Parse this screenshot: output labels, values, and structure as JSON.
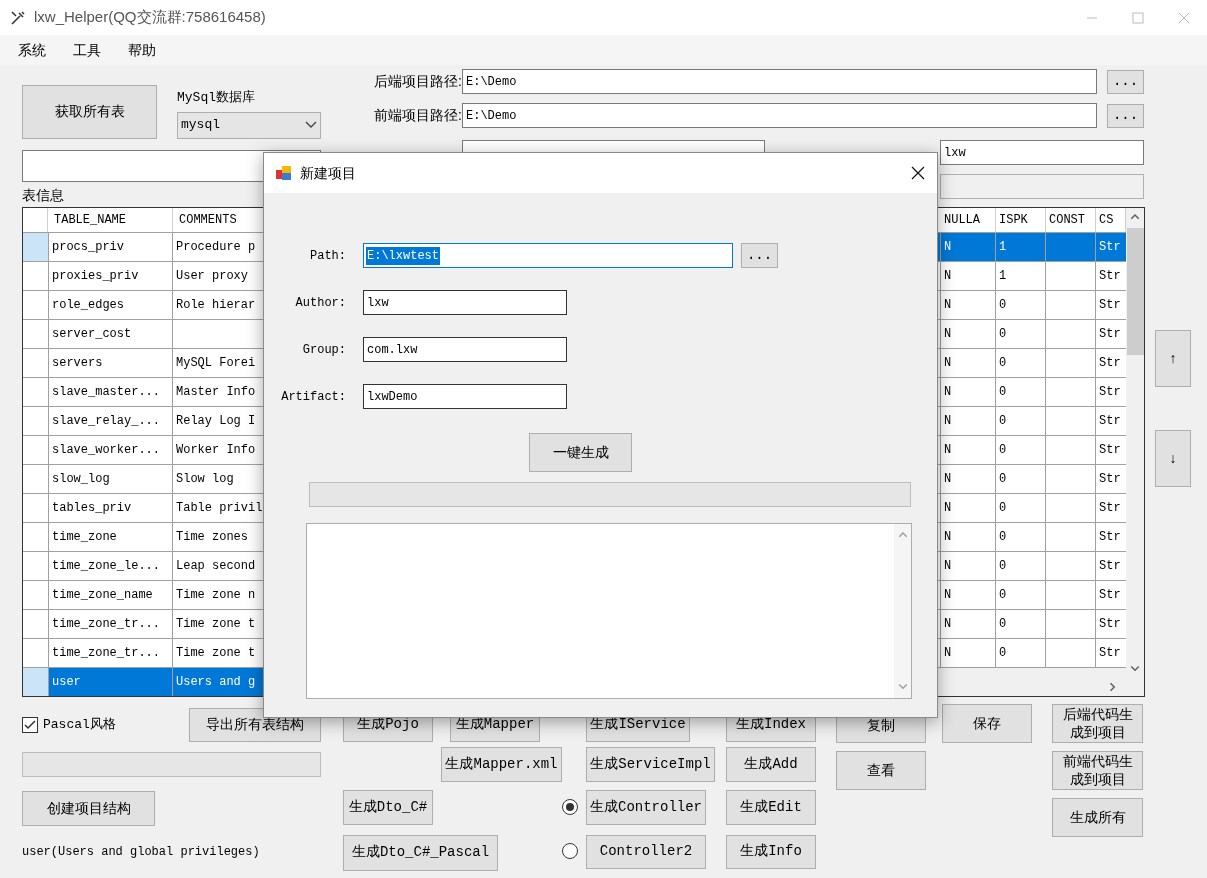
{
  "window": {
    "title": "lxw_Helper(QQ交流群:758616458)"
  },
  "menu": [
    "系统",
    "工具",
    "帮助"
  ],
  "fetch_tables_button": "获取所有表",
  "database": {
    "label": "MySql数据库",
    "value": "mysql"
  },
  "paths": [
    {
      "label": "后端项目路径:",
      "value": "E:\\Demo",
      "browse": "..."
    },
    {
      "label": "前端项目路径:",
      "value": "E:\\Demo",
      "browse": "..."
    }
  ],
  "author": {
    "value": "lxw"
  },
  "progress": {
    "level": 0
  },
  "table_info_label": "表信息",
  "tables_grid": {
    "columns": [
      "TABLE_NAME",
      "COMMENTS"
    ],
    "rows": [
      {
        "name": "procs_priv",
        "comment": "Procedure p",
        "selected": false
      },
      {
        "name": "proxies_priv",
        "comment": "User proxy",
        "selected": false
      },
      {
        "name": "role_edges",
        "comment": "Role hierar",
        "selected": false
      },
      {
        "name": "server_cost",
        "selected": false
      },
      {
        "name": "servers",
        "comment": "MySQL Forei",
        "selected": false
      },
      {
        "name": "slave_master...",
        "comment": "Master Info",
        "selected": false
      },
      {
        "name": "slave_relay_...",
        "comment": "Relay Log I",
        "selected": false
      },
      {
        "name": "slave_worker...",
        "comment": "Worker Info",
        "selected": false
      },
      {
        "name": "slow_log",
        "comment": "Slow log",
        "selected": false
      },
      {
        "name": "tables_priv",
        "comment": "Table privil",
        "selected": false
      },
      {
        "name": "time_zone",
        "comment": "Time zones",
        "selected": false
      },
      {
        "name": "time_zone_le...",
        "comment": "Leap second",
        "selected": false
      },
      {
        "name": "time_zone_name",
        "comment": "Time zone n",
        "selected": false
      },
      {
        "name": "time_zone_tr...",
        "comment": "Time zone t",
        "selected": false
      },
      {
        "name": "time_zone_tr...",
        "comment": "Time zone t",
        "selected": false
      },
      {
        "name": "user",
        "comment": "Users and g",
        "selected": true
      }
    ]
  },
  "columns_grid": {
    "columns": [
      "NULLA",
      "ISPK",
      "CONST",
      "CS"
    ],
    "rows": [
      {
        "nullable": "N",
        "ispk": "1",
        "type": "Str",
        "selected": true
      },
      {
        "nullable": "N",
        "ispk": "1",
        "type": "Str",
        "selected": false
      },
      {
        "nullable": "N",
        "ispk": "0",
        "type": "Str",
        "selected": false
      },
      {
        "nullable": "N",
        "ispk": "0",
        "type": "Str",
        "selected": false
      },
      {
        "nullable": "N",
        "ispk": "0",
        "type": "Str",
        "selected": false
      },
      {
        "nullable": "N",
        "ispk": "0",
        "type": "Str",
        "selected": false
      },
      {
        "nullable": "N",
        "ispk": "0",
        "type": "Str",
        "selected": false
      },
      {
        "nullable": "N",
        "ispk": "0",
        "type": "Str",
        "selected": false
      },
      {
        "nullable": "N",
        "ispk": "0",
        "type": "Str",
        "selected": false
      },
      {
        "nullable": "N",
        "ispk": "0",
        "type": "Str",
        "selected": false
      },
      {
        "nullable": "N",
        "ispk": "0",
        "type": "Str",
        "selected": false
      },
      {
        "nullable": "N",
        "ispk": "0",
        "type": "Str",
        "selected": false
      },
      {
        "nullable": "N",
        "ispk": "0",
        "type": "Str",
        "selected": false
      },
      {
        "nullable": "N",
        "ispk": "0",
        "type": "Str",
        "selected": false
      },
      {
        "nullable": "N",
        "ispk": "0",
        "type": "Str",
        "selected": false
      }
    ]
  },
  "move_buttons": [
    "↑",
    "↓"
  ],
  "pascal_style": {
    "label": "Pascal风格",
    "checked": true
  },
  "export_button": "导出所有表结构",
  "create_project_button": "创建项目结构",
  "selected_table": "user(Users and global privileges)",
  "entity_buttons": [
    "生成Pojo",
    "生成Dto_C#",
    "生成Dto_C#_Pascal"
  ],
  "mapper_buttons": [
    "生成Mapper",
    "生成Mapper.xml"
  ],
  "controller_mode": [
    {
      "selected": true
    },
    {
      "selected": false
    }
  ],
  "service_buttons": [
    "生成IService",
    "生成ServiceImpl",
    "生成Controller",
    "Controller2"
  ],
  "view_buttons": [
    "生成Index",
    "生成Add",
    "生成Edit",
    "生成Info"
  ],
  "copy_buttons": [
    "复制",
    "查看"
  ],
  "save_button": "保存",
  "project_buttons": [
    "后端代码生成到项目",
    "前端代码生成到项目",
    "生成所有"
  ],
  "dialog": {
    "title": "新建项目",
    "fields": [
      {
        "label": "Path:",
        "value": "E:\\lxwtest",
        "focused": true
      },
      {
        "label": "Author:",
        "value": "lxw",
        "focused": false
      },
      {
        "label": "Group:",
        "value": "com.lxw",
        "focused": false
      },
      {
        "label": "Artifact:",
        "value": "lxwDemo",
        "focused": false
      }
    ],
    "browse": "...",
    "generate_button": "一键生成",
    "progress": {
      "level": 0
    }
  }
}
